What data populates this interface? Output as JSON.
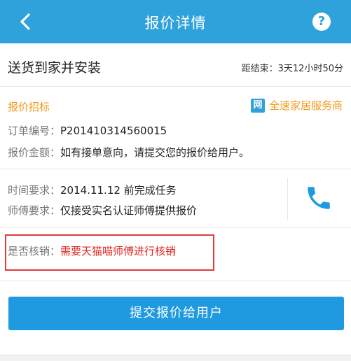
{
  "header": {
    "title": "报价详情",
    "help": "?"
  },
  "order": {
    "service_name": "送货到家并安装",
    "countdown": "距结束：3天12小时50分"
  },
  "bid": {
    "section_label": "报价招标",
    "provider_logo_text": "网",
    "provider_name": "全速家居服务商",
    "order_no_label": "订单编号：",
    "order_no": "P201410314560015",
    "amount_label": "报价金额：",
    "amount_text": "如有接单意向，请提交您的报价给用户。"
  },
  "requirements": {
    "time_label": "时间要求：",
    "time_value": "2014.11.12 前完成任务",
    "worker_label": "师傅要求：",
    "worker_value": "仅接受实名认证师傅提供报价"
  },
  "verify": {
    "label": "是否核销：",
    "value": "需要天猫喵师傅进行核销"
  },
  "actions": {
    "submit_label": "提交报价给用户"
  },
  "colors": {
    "header": "#2fa2db",
    "accent_orange": "#f39a1e",
    "highlight_red": "#e0241f",
    "button_blue": "#1f9ae0"
  }
}
